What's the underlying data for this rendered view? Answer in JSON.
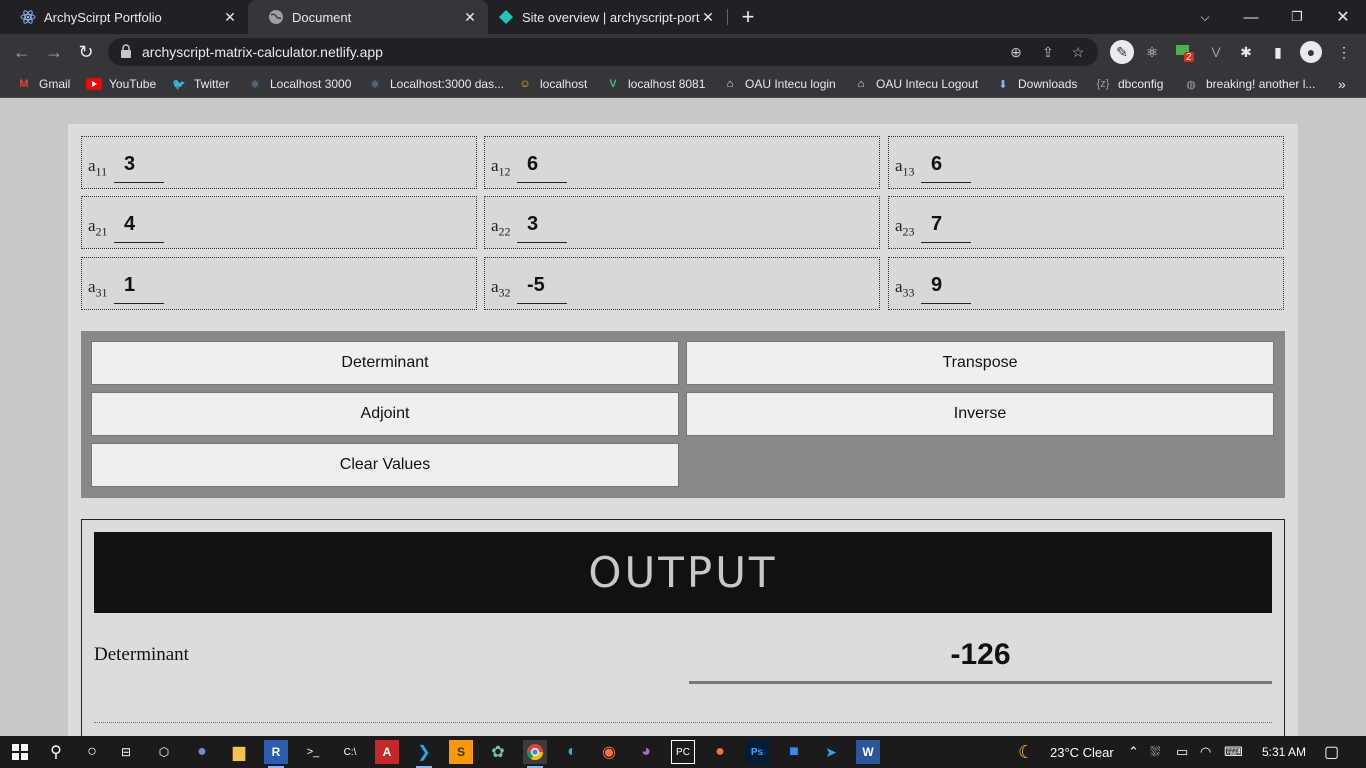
{
  "browser": {
    "tabs": [
      {
        "title": "ArchyScirpt Portfolio",
        "icon": "react-icon",
        "active": false
      },
      {
        "title": "Document",
        "icon": "globe-icon",
        "active": true
      },
      {
        "title": "Site overview | archyscript-portfo",
        "icon": "netlify-icon",
        "active": false
      }
    ],
    "url": "archyscript-matrix-calculator.netlify.app",
    "bookmarks": [
      {
        "label": "Gmail",
        "icon": "gmail-icon"
      },
      {
        "label": "YouTube",
        "icon": "youtube-icon"
      },
      {
        "label": "Twitter",
        "icon": "twitter-icon"
      },
      {
        "label": "Localhost 3000",
        "icon": "react-icon"
      },
      {
        "label": "Localhost:3000 das...",
        "icon": "react-icon"
      },
      {
        "label": "localhost",
        "icon": "avatar-icon"
      },
      {
        "label": "localhost 8081",
        "icon": "vue-icon"
      },
      {
        "label": "OAU Intecu login",
        "icon": "house-icon"
      },
      {
        "label": "OAU Intecu Logout",
        "icon": "house-icon"
      },
      {
        "label": "Downloads",
        "icon": "download-icon"
      },
      {
        "label": "dbconfig",
        "icon": "braces-icon"
      },
      {
        "label": "breaking! another l...",
        "icon": "globe-icon"
      }
    ],
    "more_bookmarks": "»",
    "extension_badge": "2"
  },
  "matrix": {
    "cells": [
      {
        "label": "a",
        "sub": "11",
        "value": "3"
      },
      {
        "label": "a",
        "sub": "12",
        "value": "6"
      },
      {
        "label": "a",
        "sub": "13",
        "value": "6"
      },
      {
        "label": "a",
        "sub": "21",
        "value": "4"
      },
      {
        "label": "a",
        "sub": "22",
        "value": "3"
      },
      {
        "label": "a",
        "sub": "23",
        "value": "7"
      },
      {
        "label": "a",
        "sub": "31",
        "value": "1"
      },
      {
        "label": "a",
        "sub": "32",
        "value": "-5"
      },
      {
        "label": "a",
        "sub": "33",
        "value": "9"
      }
    ]
  },
  "actions": {
    "determinant": "Determinant",
    "transpose": "Transpose",
    "adjoint": "Adjoint",
    "inverse": "Inverse",
    "clear": "Clear Values"
  },
  "output": {
    "heading": "OUTPUT",
    "result_label": "Determinant",
    "result_value": "-126"
  },
  "taskbar": {
    "weather": "23°C  Clear",
    "time": "5:31 AM"
  },
  "colors": {
    "page_bg": "#c8c8c8",
    "container_bg": "#dcdcdc",
    "action_panel_bg": "#888888",
    "output_header_bg": "#111111",
    "chrome_dark": "#202124",
    "chrome_toolbar": "#35363a"
  }
}
